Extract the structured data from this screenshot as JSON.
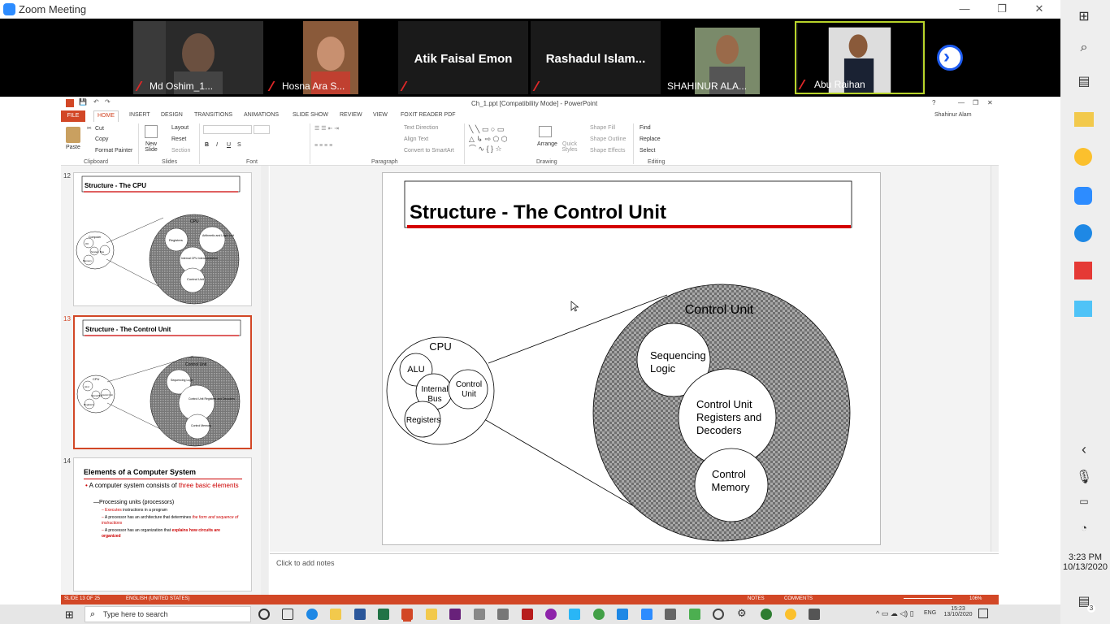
{
  "zoom": {
    "title": "Zoom Meeting",
    "participants": [
      {
        "name": "Md Oshim_1..."
      },
      {
        "name": "Hosna Ara S..."
      },
      {
        "name": "Atik Faisal Emon"
      },
      {
        "name": "Rashadul  Islam..."
      },
      {
        "name": "SHAHINUR ALA..."
      },
      {
        "name": "Abu Raihan"
      }
    ]
  },
  "ppt": {
    "title": "Ch_1.ppt [Compatibility Mode] - PowerPoint",
    "user": "Shahinur Alam",
    "tabs": [
      "FILE",
      "HOME",
      "INSERT",
      "DESIGN",
      "TRANSITIONS",
      "ANIMATIONS",
      "SLIDE SHOW",
      "REVIEW",
      "VIEW",
      "FOXIT READER PDF"
    ],
    "ribbon": {
      "paste": "Paste",
      "cut": "Cut",
      "copy": "Copy",
      "format_painter": "Format Painter",
      "new_slide": "New Slide",
      "layout": "Layout",
      "reset": "Reset",
      "section": "Section",
      "text_direction": "Text Direction",
      "align_text": "Align Text",
      "convert_smartart": "Convert to SmartArt",
      "arrange": "Arrange",
      "quick_styles": "Quick Styles",
      "shape_fill": "Shape Fill",
      "shape_outline": "Shape Outline",
      "shape_effects": "Shape Effects",
      "find": "Find",
      "replace": "Replace",
      "select": "Select",
      "groups": [
        "Clipboard",
        "Slides",
        "Font",
        "Paragraph",
        "Drawing",
        "Editing"
      ]
    },
    "thumbs": [
      {
        "num": "12",
        "title": "Structure - The CPU",
        "labels": [
          "CPU",
          "Registers",
          "Arithmetic and Logic Unit",
          "Internal CPU Interconnection",
          "Control Unit",
          "Computer",
          "I/O",
          "System Bus",
          "Memory"
        ]
      },
      {
        "num": "13",
        "title": "Structure - The Control Unit",
        "labels": [
          "Control Unit",
          "Sequencing Logic",
          "Control Unit Registers and Decoders",
          "Control Memory",
          "CPU",
          "ALU",
          "Internal Bus",
          "Registers",
          "Control Unit"
        ]
      },
      {
        "num": "14",
        "title": "Elements of a Computer System",
        "b1a": "A computer system consists of ",
        "b1b": "three basic elements",
        "b2": "Processing units (processors)",
        "b3a": "Executes",
        "b3b": " instructions in a program",
        "b4a": "A processor has an architecture that determines ",
        "b4b": "the form and sequence of instructions",
        "b5a": "A processor has an organization that ",
        "b5b": "explains how circuits are organized"
      }
    ],
    "slide": {
      "title": "Structure - The Control Unit",
      "cpu": "CPU",
      "alu": "ALU",
      "internal_bus": [
        "Internal",
        "Bus"
      ],
      "control_unit_small": [
        "Control",
        "Unit"
      ],
      "registers": "Registers",
      "control_unit_big": "Control Unit",
      "sequencing": [
        "Sequencing",
        "Logic"
      ],
      "registers_decoders": [
        "Control Unit",
        "Registers and",
        "Decoders"
      ],
      "control_memory": [
        "Control",
        "Memory"
      ]
    },
    "notes_placeholder": "Click to add notes",
    "status": {
      "slide": "SLIDE 13 OF 25",
      "language": "ENGLISH (UNITED STATES)",
      "notes": "NOTES",
      "comments": "COMMENTS",
      "zoom": "106%"
    }
  },
  "taskbar": {
    "search_placeholder": "Type here to search",
    "lang": "ENG",
    "time": "15:23",
    "date": "13/10/2020"
  },
  "sidebar": {
    "time": "3:23 PM",
    "date": "10/13/2020",
    "notif": "3"
  },
  "colors": {
    "accent": "#d24726",
    "zoom_blue": "#2d8cff",
    "muted_red": "#e02828"
  }
}
